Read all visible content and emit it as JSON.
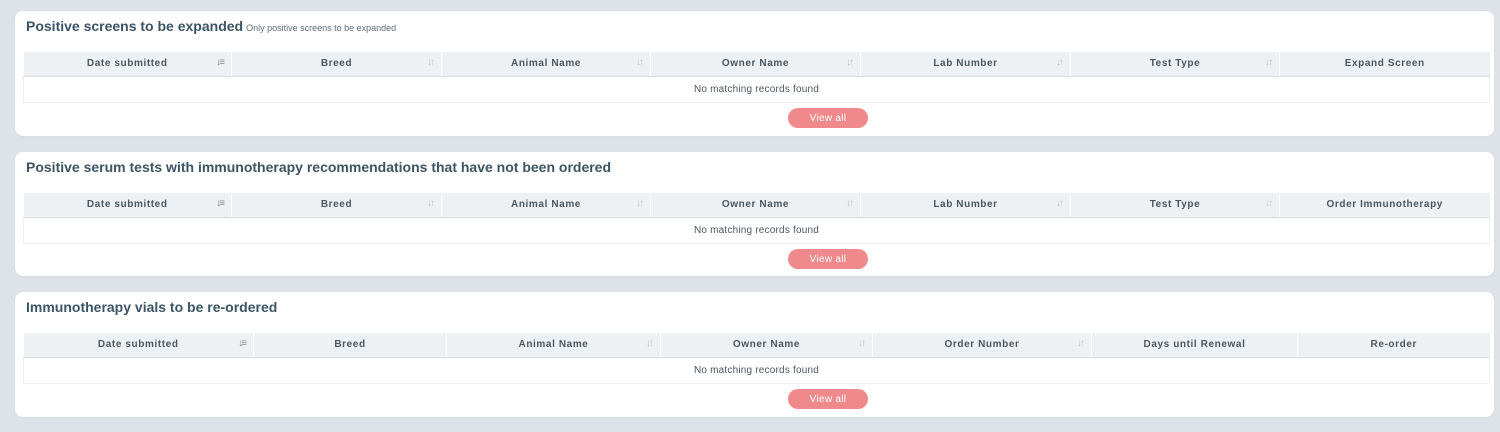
{
  "sections": [
    {
      "title": "Positive screens to be expanded",
      "subtitle": "Only positive screens to be expanded",
      "columns": [
        "Date submitted",
        "Breed",
        "Animal Name",
        "Owner Name",
        "Lab Number",
        "Test Type",
        "Expand Screen"
      ],
      "empty_message": "No matching records found",
      "button_label": "View all"
    },
    {
      "title": "Positive serum tests with immunotherapy recommendations that have not been ordered",
      "columns": [
        "Date submitted",
        "Breed",
        "Animal Name",
        "Owner Name",
        "Lab Number",
        "Test Type",
        "Order Immunotherapy"
      ],
      "empty_message": "No matching records found",
      "button_label": "View all"
    },
    {
      "title": "Immunotherapy vials to be re-ordered",
      "columns": [
        "Date submitted",
        "Breed",
        "Animal Name",
        "Owner Name",
        "Order Number",
        "Days until Renewal",
        "Re-order"
      ],
      "empty_message": "No matching records found",
      "button_label": "View all"
    }
  ],
  "icons": {
    "sort_active": "sort-desc-icon",
    "sort_inactive": "sort-both-icon"
  },
  "colors": {
    "background": "#dde3e8",
    "header_bg": "#edf1f4",
    "button": "#f0898b",
    "title": "#3b5566"
  }
}
